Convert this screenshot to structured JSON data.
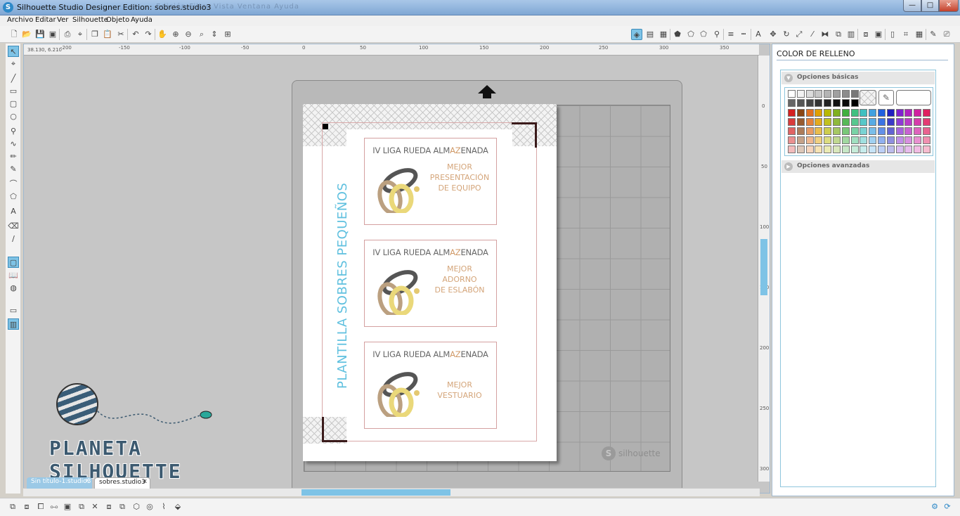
{
  "window": {
    "title": "Silhouette Studio Designer Edition: sobres.studio3",
    "ghost_menu": "Edición  Filtro  Vista  Ventana  Ayuda",
    "minimize": "—",
    "maximize": "□",
    "close": "✕"
  },
  "menu": [
    "Archivo",
    "Editar",
    "Ver",
    "Silhouette",
    "Objeto",
    "Ayuda"
  ],
  "ruler": {
    "coords": "38.130, 6.210",
    "h_labels": [
      "-200",
      "-150",
      "-100",
      "-50",
      "0",
      "50",
      "100",
      "150",
      "200",
      "250",
      "300",
      "350"
    ],
    "v_labels": [
      "0",
      "50",
      "100",
      "150",
      "200",
      "250",
      "300"
    ]
  },
  "document": {
    "side_title": "PLANTILLA SOBRES PEQUEÑOS",
    "cards": [
      {
        "head_a": "IV LIGA RUEDA ALM",
        "head_b": "AZ",
        "head_c": "ENADA",
        "lines": [
          "MEJOR",
          "PRESENTACIÓN",
          "DE EQUIPO"
        ]
      },
      {
        "head_a": "IV LIGA RUEDA ALM",
        "head_b": "AZ",
        "head_c": "ENADA",
        "lines": [
          "MEJOR",
          "ADORNO",
          "DE ESLABÓN"
        ]
      },
      {
        "head_a": "IV LIGA RUEDA ALM",
        "head_b": "AZ",
        "head_c": "ENADA",
        "lines": [
          "MEJOR",
          "VESTUARIO"
        ]
      }
    ],
    "mat_brand": "silhouette",
    "mat_brand_icon": "S"
  },
  "tabs": [
    {
      "label": "Sin título-1.studio3",
      "close": "x"
    },
    {
      "label": "sobres.studio3",
      "close": "x"
    }
  ],
  "right_panel": {
    "title": "COLOR DE RELLENO",
    "basic_options": "Opciones básicas",
    "advanced_options": "Opciones avanzadas",
    "grays": [
      "#ffffff",
      "#f2f2f2",
      "#dcdcdc",
      "#c8c8c8",
      "#b4b4b4",
      "#a0a0a0",
      "#8c8c8c",
      "#787878",
      "#666666",
      "#555555",
      "#444444",
      "#333333",
      "#222222",
      "#111111",
      "#0a0a0a",
      "#000000"
    ],
    "hues": [
      "#d42020",
      "#8b4513",
      "#e07020",
      "#e0a000",
      "#b8b800",
      "#80b020",
      "#40b040",
      "#40c080",
      "#40c0c0",
      "#40a0e0",
      "#2060e0",
      "#2020c0",
      "#8020d0",
      "#b020c0",
      "#d020a0",
      "#e02060"
    ]
  },
  "watermark": {
    "text": "PLANETA SILHOUETTE"
  },
  "colors": {
    "accent": "#7ec3e6",
    "title_blue": "#5fc0df",
    "card_text": "#d4a57a"
  }
}
